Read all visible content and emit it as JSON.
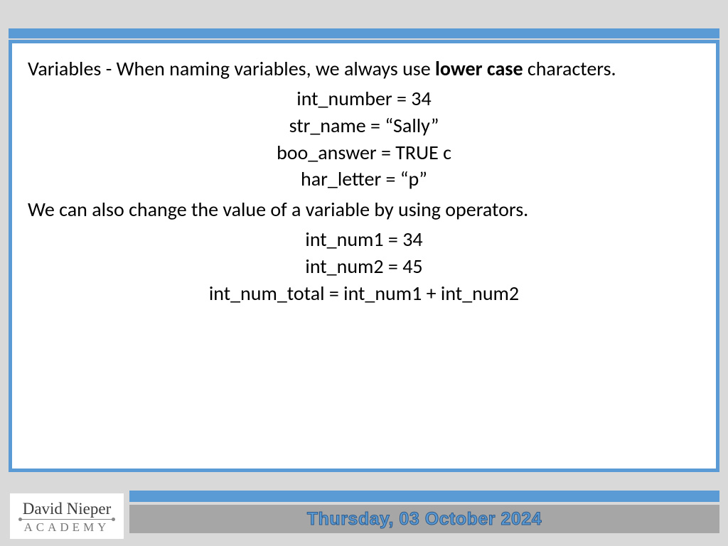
{
  "intro": {
    "prefix": "Variables - When naming variables, we always use ",
    "bold": "lower case",
    "suffix": " characters."
  },
  "examples1": [
    "int_number = 34",
    "str_name = “Sally”",
    "boo_answer = TRUE c",
    "har_letter = “p”"
  ],
  "mid": "We can also change the value of a variable by using operators.",
  "examples2": [
    "int_num1 = 34",
    "int_num2 = 45",
    "int_num_total = int_num1 + int_num2"
  ],
  "footer": {
    "date": "Thursday, 03 October 2024"
  },
  "logo": {
    "top": "David Nieper",
    "bottom": "ACADEMY"
  }
}
